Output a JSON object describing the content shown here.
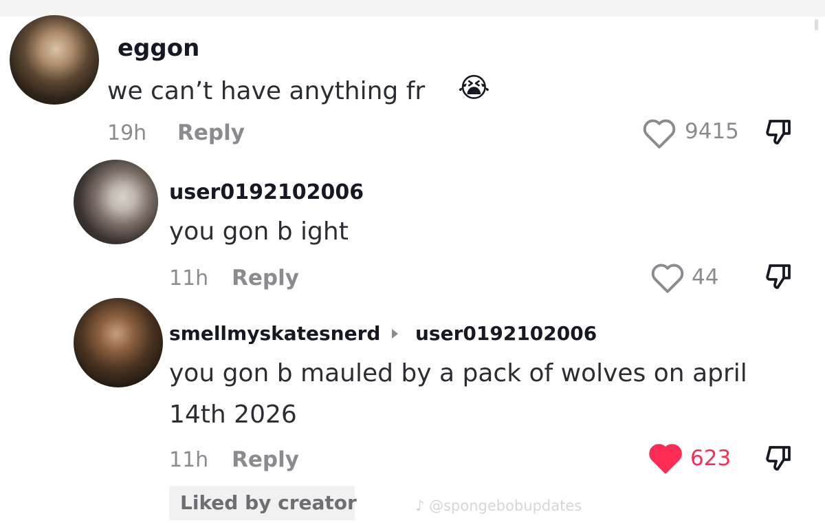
{
  "comments": [
    {
      "username": "eggon",
      "text": "we can’t have anything fr",
      "emoji": "😭",
      "time": "19h",
      "reply_label": "Reply",
      "likes": "9415",
      "liked": false,
      "avatar_icon": "avatar-photo"
    },
    {
      "username": "user0192102006",
      "text": "you gon b ight",
      "time": "11h",
      "reply_label": "Reply",
      "likes": "44",
      "liked": false,
      "avatar_icon": "avatar-photo"
    },
    {
      "username": "smellmyskatesnerd",
      "reply_to": "user0192102006",
      "text_line1": "you gon b mauled by a pack of wolves on april",
      "text_line2": "14th 2026",
      "time": "11h",
      "reply_label": "Reply",
      "likes": "623",
      "liked": true,
      "liked_by_creator": "Liked by creator",
      "avatar_icon": "avatar-photo"
    }
  ],
  "watermark": "♪ @spongebobupdates",
  "colors": {
    "liked_heart": "#fe2c55",
    "muted_text": "#8a8b91",
    "primary_text": "#161823"
  },
  "icons": {
    "like": "heart-outline-icon",
    "liked": "heart-filled-icon",
    "dislike": "thumbs-down-icon",
    "reply_arrow": "reply-arrow-icon"
  }
}
